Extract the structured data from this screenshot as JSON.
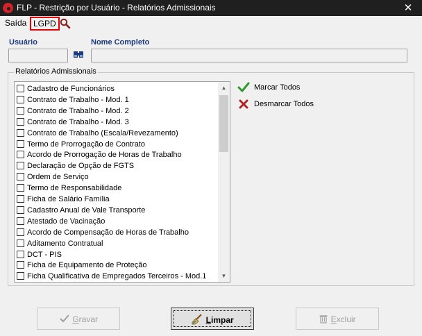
{
  "window": {
    "title": "FLP - Restrição por Usuário - Relatórios Admissionais",
    "close_glyph": "✕"
  },
  "menu": {
    "saida": "Saída",
    "lgpd": "LGPD",
    "search_icon": "magnifier-icon"
  },
  "fields": {
    "usuario_label": "Usuário",
    "usuario_value": "",
    "nome_label": "Nome Completo",
    "nome_value": ""
  },
  "group": {
    "title": "Relatórios Admissionais"
  },
  "reports": [
    "Cadastro de Funcionários",
    "Contrato de Trabalho - Mod. 1",
    "Contrato de Trabalho - Mod. 2",
    "Contrato de Trabalho - Mod. 3",
    "Contrato de Trabalho (Escala/Revezamento)",
    "Termo de Prorrogação de Contrato",
    "Acordo de Prorrogação de Horas de Trabalho",
    "Declaração de Opção de FGTS",
    "Ordem de Serviço",
    "Termo de Responsabilidade",
    "Ficha de Salário Família",
    "Cadastro Anual de Vale Transporte",
    "Atestado de Vacinação",
    "Acordo de Compensação de Horas de Trabalho",
    "Aditamento Contratual",
    "DCT - PIS",
    "Ficha de Equipamento de Proteção",
    "Ficha Qualificativa de Empregados Terceiros - Mod.1"
  ],
  "actions": {
    "marcar": "Marcar Todos",
    "desmarcar": "Desmarcar Todos"
  },
  "buttons": {
    "gravar_first": "G",
    "gravar_rest": "ravar",
    "limpar_first": "L",
    "limpar_rest": "impar",
    "excluir_first": "E",
    "excluir_rest": "xcluir"
  },
  "colors": {
    "label_blue": "#1c3a7a",
    "check_green": "#2e9a2e",
    "x_red": "#b22222",
    "highlight_red": "#e00000"
  }
}
